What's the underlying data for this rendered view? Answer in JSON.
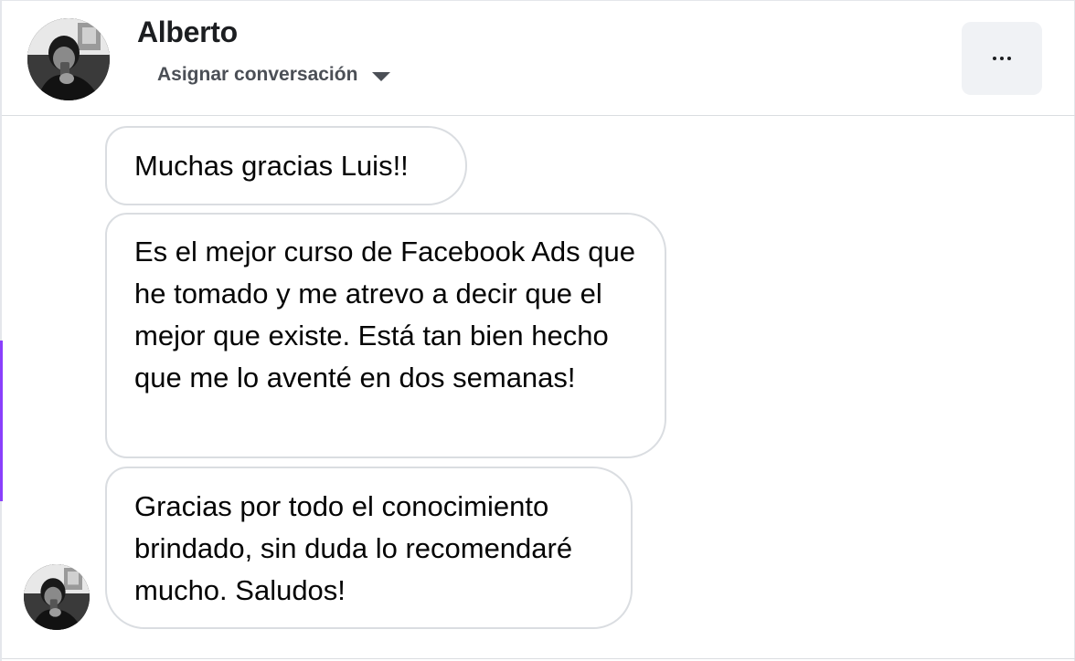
{
  "header": {
    "contact_name": "Alberto",
    "assign_label": "Asignar conversación",
    "assign_icon": "caret-down-icon",
    "more_icon": "more-horizontal-icon"
  },
  "messages": [
    {
      "text": "Muchas gracias Luis!!"
    },
    {
      "text": "Es el mejor curso de Facebook Ads que he tomado y me atrevo a decir que el mejor que existe. Está tan bien hecho que me lo aventé en dos semanas!"
    },
    {
      "text": "Gracias por todo el conocimiento brindado, sin duda lo recomendaré mucho. Saludos!"
    }
  ],
  "colors": {
    "accent": "#8a3ffc",
    "border": "#dadde1",
    "text": "#050505",
    "button_bg": "#f0f2f5"
  }
}
